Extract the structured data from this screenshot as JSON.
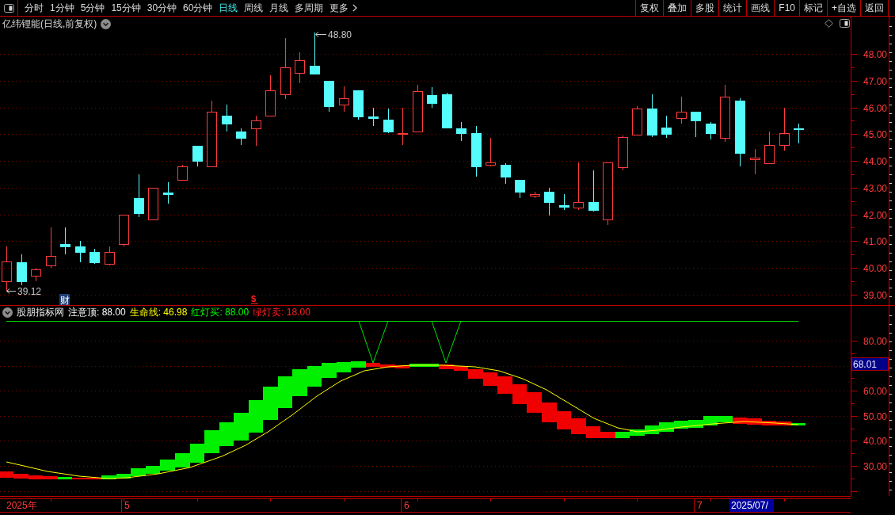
{
  "toolbar": {
    "periods": [
      {
        "label": "分时",
        "selected": false
      },
      {
        "label": "1分钟",
        "selected": false
      },
      {
        "label": "5分钟",
        "selected": false
      },
      {
        "label": "15分钟",
        "selected": false
      },
      {
        "label": "30分钟",
        "selected": false
      },
      {
        "label": "60分钟",
        "selected": false
      },
      {
        "label": "日线",
        "selected": true
      },
      {
        "label": "周线",
        "selected": false
      },
      {
        "label": "月线",
        "selected": false
      },
      {
        "label": "多周期",
        "selected": false
      }
    ],
    "more_menu": {
      "label": "更多"
    },
    "buttons": [
      "复权",
      "叠加",
      "多股",
      "统计",
      "画线",
      "F10",
      "标记",
      "+自选",
      "返回"
    ]
  },
  "price_panel": {
    "title": "亿纬锂能(日线,前复权)",
    "axis_labels": [
      "48.00",
      "47.00",
      "46.00",
      "45.00",
      "44.00",
      "43.00",
      "42.00",
      "41.00",
      "40.00",
      "39.00"
    ],
    "high_label": "48.80",
    "low_label": "39.12",
    "markers": [
      {
        "kind": "finance",
        "label": "财"
      },
      {
        "kind": "dividend",
        "label": "$"
      }
    ]
  },
  "indicator_panel": {
    "name": "股朋指标网",
    "readings": [
      {
        "label": "注意顶: 88.00",
        "color": "#ffffff"
      },
      {
        "label": "生命线: 46.98",
        "color": "#ffff00"
      },
      {
        "label": "红灯买: 88.00",
        "color": "#00ff00"
      },
      {
        "label": "绿灯卖: 18.00",
        "color": "#ff2020"
      }
    ],
    "axis_labels": [
      "80.00",
      "60.00",
      "50.00",
      "40.00",
      "30.00"
    ],
    "cursor_value": "68.01"
  },
  "time_axis": {
    "labels": [
      "2025年",
      "5",
      "6",
      "7"
    ],
    "cursor_date": "2025/07/"
  }
}
